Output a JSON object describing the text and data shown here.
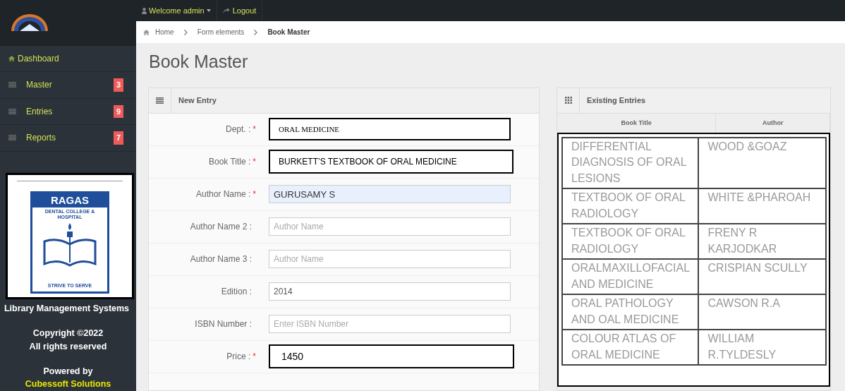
{
  "topbar": {
    "user_menu": "Welcome admin",
    "logout": "Logout"
  },
  "breadcrumb": [
    {
      "label": "Home",
      "current": false
    },
    {
      "label": "Form elements",
      "current": false
    },
    {
      "label": "Book Master",
      "current": true
    }
  ],
  "sidebar": {
    "items": [
      {
        "label": "Dashboard",
        "kind": "home"
      },
      {
        "label": "Master",
        "kind": "menu",
        "badge": "3"
      },
      {
        "label": "Entries",
        "kind": "menu",
        "badge": "9"
      },
      {
        "label": "Reports",
        "kind": "menu",
        "badge": "7"
      }
    ],
    "logo": {
      "name": "RAGAS",
      "subtitle": "DENTAL COLLEGE & HOSPITAL",
      "motto": "STRIVE TO SERVE"
    },
    "app_name": "Library Management Systems",
    "copyright": [
      "Copyright ©2022",
      "All rights reserved"
    ],
    "powered_by": "Powered by",
    "vendor": "Cubessoft Solutions"
  },
  "page_title": "Book Master",
  "new_entry": {
    "title": "New Entry",
    "fields": [
      {
        "label": "Dept. :",
        "required_mark": "*",
        "value": "ORAL MEDICINE",
        "kind": "serif"
      },
      {
        "label": "Book Title :",
        "required_mark": "*",
        "value": "BURKETT’S TEXTBOOK OF ORAL MEDICINE",
        "kind": "boxed"
      },
      {
        "label": "Author Name :",
        "required_mark": "*",
        "value": "GURUSAMY S",
        "kind": "autofill"
      },
      {
        "label": "Author Name 2 :",
        "placeholder": "Author Name",
        "kind": "plain"
      },
      {
        "label": "Author Name 3 :",
        "placeholder": "Author Name",
        "kind": "plain"
      },
      {
        "label": "Edition :",
        "value": "2014",
        "kind": "plain"
      },
      {
        "label": "ISBN Number :",
        "placeholder": "Enter ISBN Number",
        "kind": "plain"
      },
      {
        "label": "Price :",
        "required_mark": "*",
        "value": "1450",
        "kind": "large"
      }
    ]
  },
  "existing_entries": {
    "title": "Existing Entries",
    "columns": [
      "Book Title",
      "Author"
    ],
    "rows": [
      [
        "DIFFERENTIAL DIAGNOSIS OF ORAL LESIONS",
        "WOOD &GOAZ"
      ],
      [
        "TEXTBOOK OF ORAL RADIOLOGY",
        "WHITE &PHAROAH"
      ],
      [
        "TEXTBOOK OF ORAL RADIOLOGY",
        "FRENY R KARJODKAR"
      ],
      [
        "ORALMAXILLOFACIAL AND MEDICINE",
        "CRISPIAN SCULLY"
      ],
      [
        "ORAL PATHOLOGY AND OAL MEDICINE",
        "CAWSON R.A"
      ],
      [
        "COLOUR ATLAS OF ORAL MEDICINE",
        "WILLIAM R.TYLDESLY"
      ]
    ]
  }
}
